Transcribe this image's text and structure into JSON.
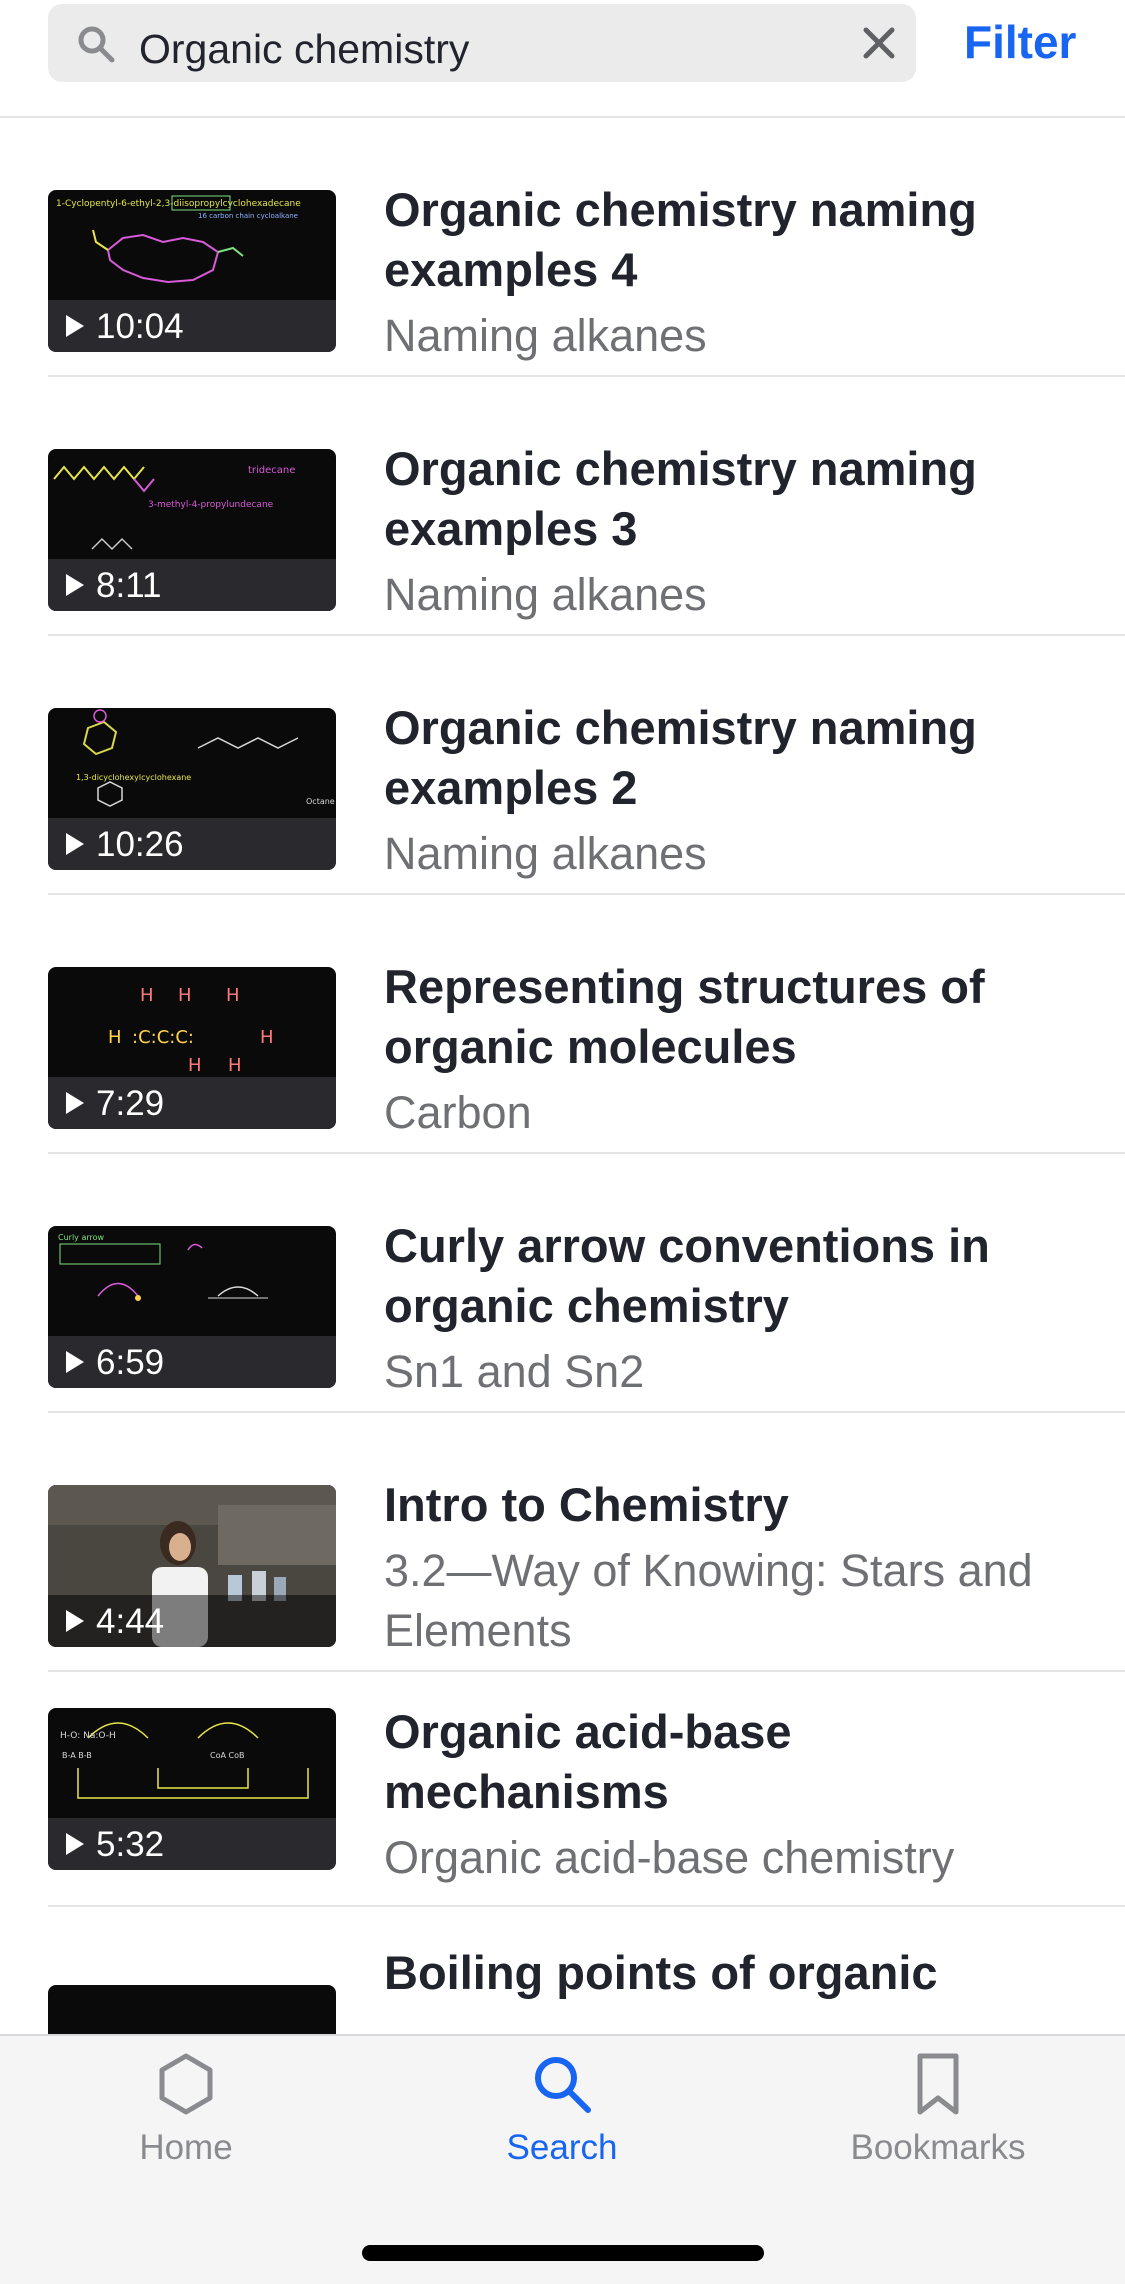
{
  "search": {
    "query": "Organic chemistry",
    "filter_label": "Filter"
  },
  "results": [
    {
      "title": "Organic chemistry naming examples 4",
      "subtitle": "Naming alkanes",
      "duration": "10:04"
    },
    {
      "title": "Organic chemistry naming examples 3",
      "subtitle": "Naming alkanes",
      "duration": "8:11"
    },
    {
      "title": "Organic chemistry naming examples 2",
      "subtitle": "Naming alkanes",
      "duration": "10:26"
    },
    {
      "title": "Representing structures of organic molecules",
      "subtitle": "Carbon",
      "duration": "7:29"
    },
    {
      "title": "Curly arrow conventions in organic chemistry",
      "subtitle": "Sn1 and Sn2",
      "duration": "6:59"
    },
    {
      "title": "Intro to Chemistry",
      "subtitle": "3.2—Way of Knowing: Stars and Elements",
      "duration": "4:44"
    },
    {
      "title": "Organic acid-base mechanisms",
      "subtitle": "Organic acid-base chemistry",
      "duration": "5:32"
    },
    {
      "title": "Boiling points of organic",
      "subtitle": "",
      "duration": ""
    }
  ],
  "tabbar": {
    "home_label": "Home",
    "search_label": "Search",
    "bookmarks_label": "Bookmarks"
  },
  "colors": {
    "accent": "#1865f2",
    "muted": "#8a8b8f",
    "text": "#21242c"
  }
}
